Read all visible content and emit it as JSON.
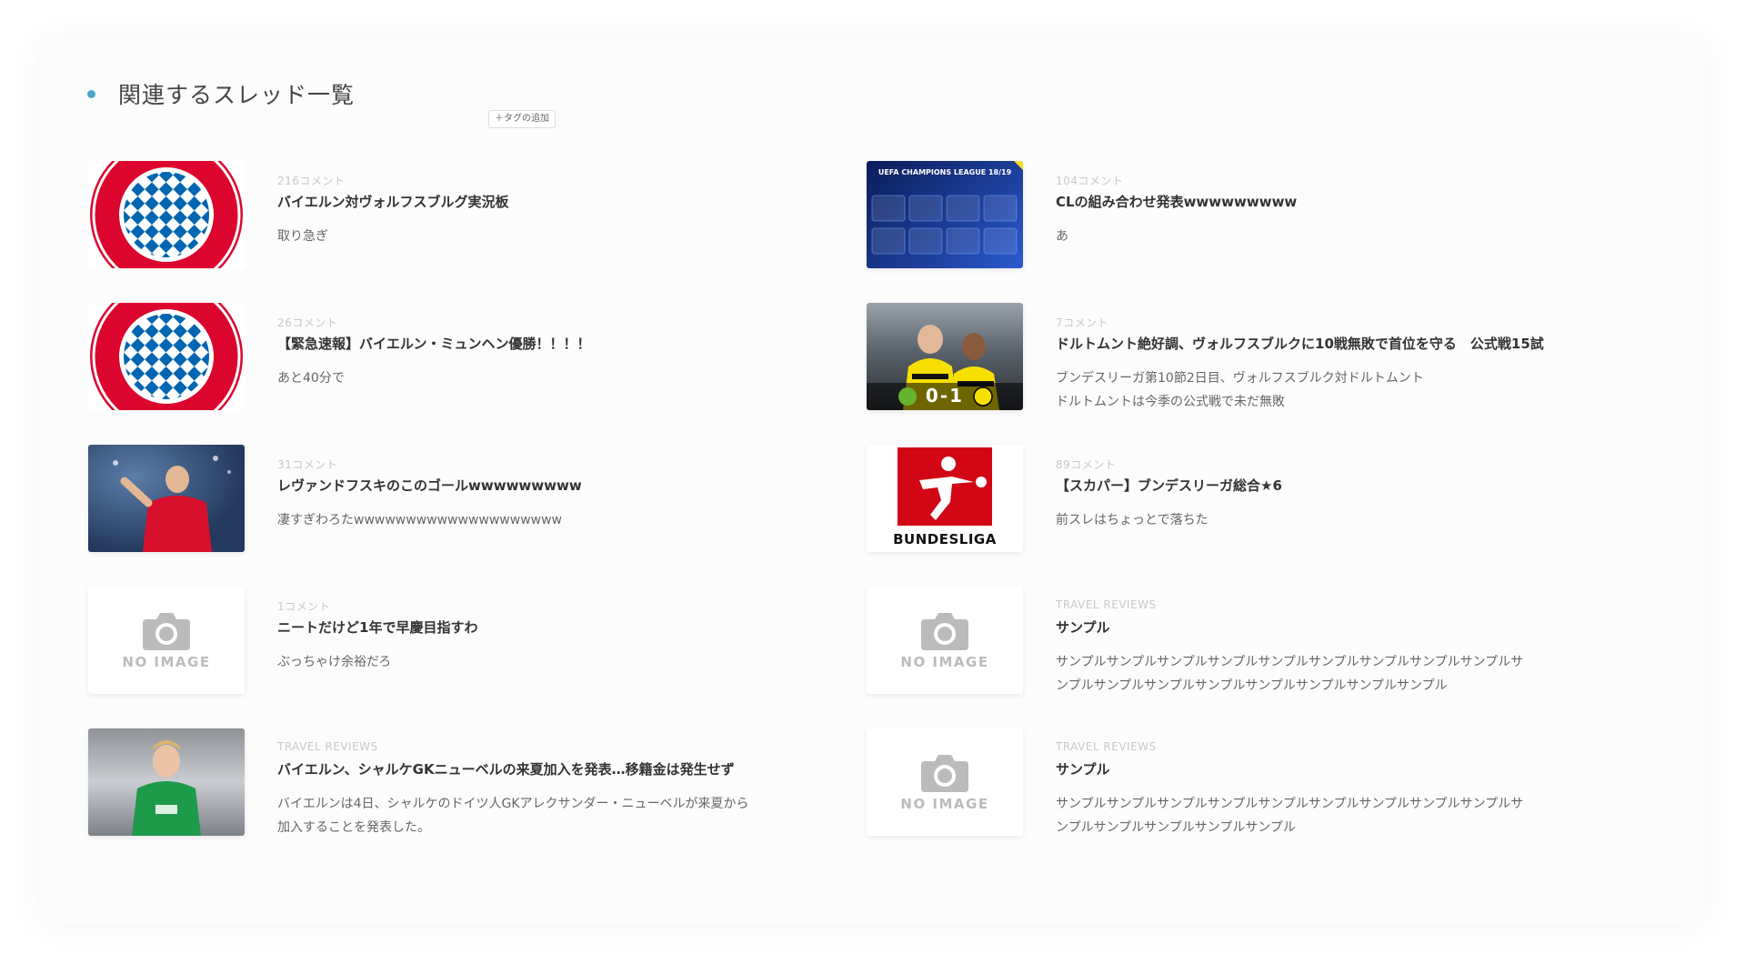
{
  "section": {
    "title": "関連するスレッド一覧",
    "tag_button": "＋タグの追加"
  },
  "colors": {
    "accent_dot": "#4aa3c8",
    "bayern_red": "#dc052d",
    "bayern_blue": "#0066b2"
  },
  "threads": [
    {
      "meta": "216コメント",
      "title": "バイエルン対ヴォルフスブルグ実況板",
      "desc": [
        "取り急ぎ"
      ],
      "thumb": "bayern-logo"
    },
    {
      "meta": "104コメント",
      "title": "CLの組み合わせ発表wwwwwwwww",
      "desc": [
        "あ"
      ],
      "thumb": "ucl-draw",
      "thumb_text": "UEFA CHAMPIONS LEAGUE 18/19"
    },
    {
      "meta": "26コメント",
      "title": "【緊急速報】バイエルン・ミュンヘン優勝！！！！",
      "desc": [
        "あと40分で"
      ],
      "thumb": "bayern-logo"
    },
    {
      "meta": "7コメント",
      "title": "ドルトムント絶好調、ヴォルフスブルクに10戦無敗で首位を守る　公式戦15試",
      "desc": [
        "ブンデスリーガ第10節2日目、ヴォルフスブルク対ドルトムント",
        "ドルトムントは今季の公式戦で未だ無敗"
      ],
      "thumb": "bvb-photo",
      "thumb_text": "0-1"
    },
    {
      "meta": "31コメント",
      "title": "レヴァンドフスキのこのゴールwwwwwwwww",
      "desc": [
        "凄すぎわろたwwwwwwwwwwwwwwwwwwww"
      ],
      "thumb": "player-red"
    },
    {
      "meta": "89コメント",
      "title": "【スカパー】ブンデスリーガ総合★6",
      "desc": [
        "前スレはちょっとで落ちた"
      ],
      "thumb": "bundesliga-logo",
      "thumb_text": "BUNDESLIGA"
    },
    {
      "meta": "1コメント",
      "title": "ニートだけど1年で早慶目指すわ",
      "desc": [
        "ぶっちゃけ余裕だろ"
      ],
      "thumb": "no-image",
      "thumb_text": "NO IMAGE"
    },
    {
      "meta": "TRAVEL REVIEWS",
      "title": "サンプル",
      "desc": [
        "サンプルサンプルサンプルサンプルサンプルサンプルサンプルサンプルサンプルサ",
        "ンプルサンプルサンプルサンプルサンプルサンプルサンプルサンプル"
      ],
      "thumb": "no-image",
      "thumb_text": "NO IMAGE"
    },
    {
      "meta": "TRAVEL REVIEWS",
      "title": "バイエルン、シャルケGKニューベルの来夏加入を発表…移籍金は発生せず",
      "desc": [
        "バイエルンは4日、シャルケのドイツ人GKアレクサンダー・ニューベルが来夏から",
        "加入することを発表した。"
      ],
      "thumb": "player-green"
    },
    {
      "meta": "TRAVEL REVIEWS",
      "title": "サンプル",
      "desc": [
        "サンプルサンプルサンプルサンプルサンプルサンプルサンプルサンプルサンプルサ",
        "ンプルサンプルサンプルサンプルサンプル"
      ],
      "thumb": "no-image",
      "thumb_text": "NO IMAGE"
    }
  ]
}
